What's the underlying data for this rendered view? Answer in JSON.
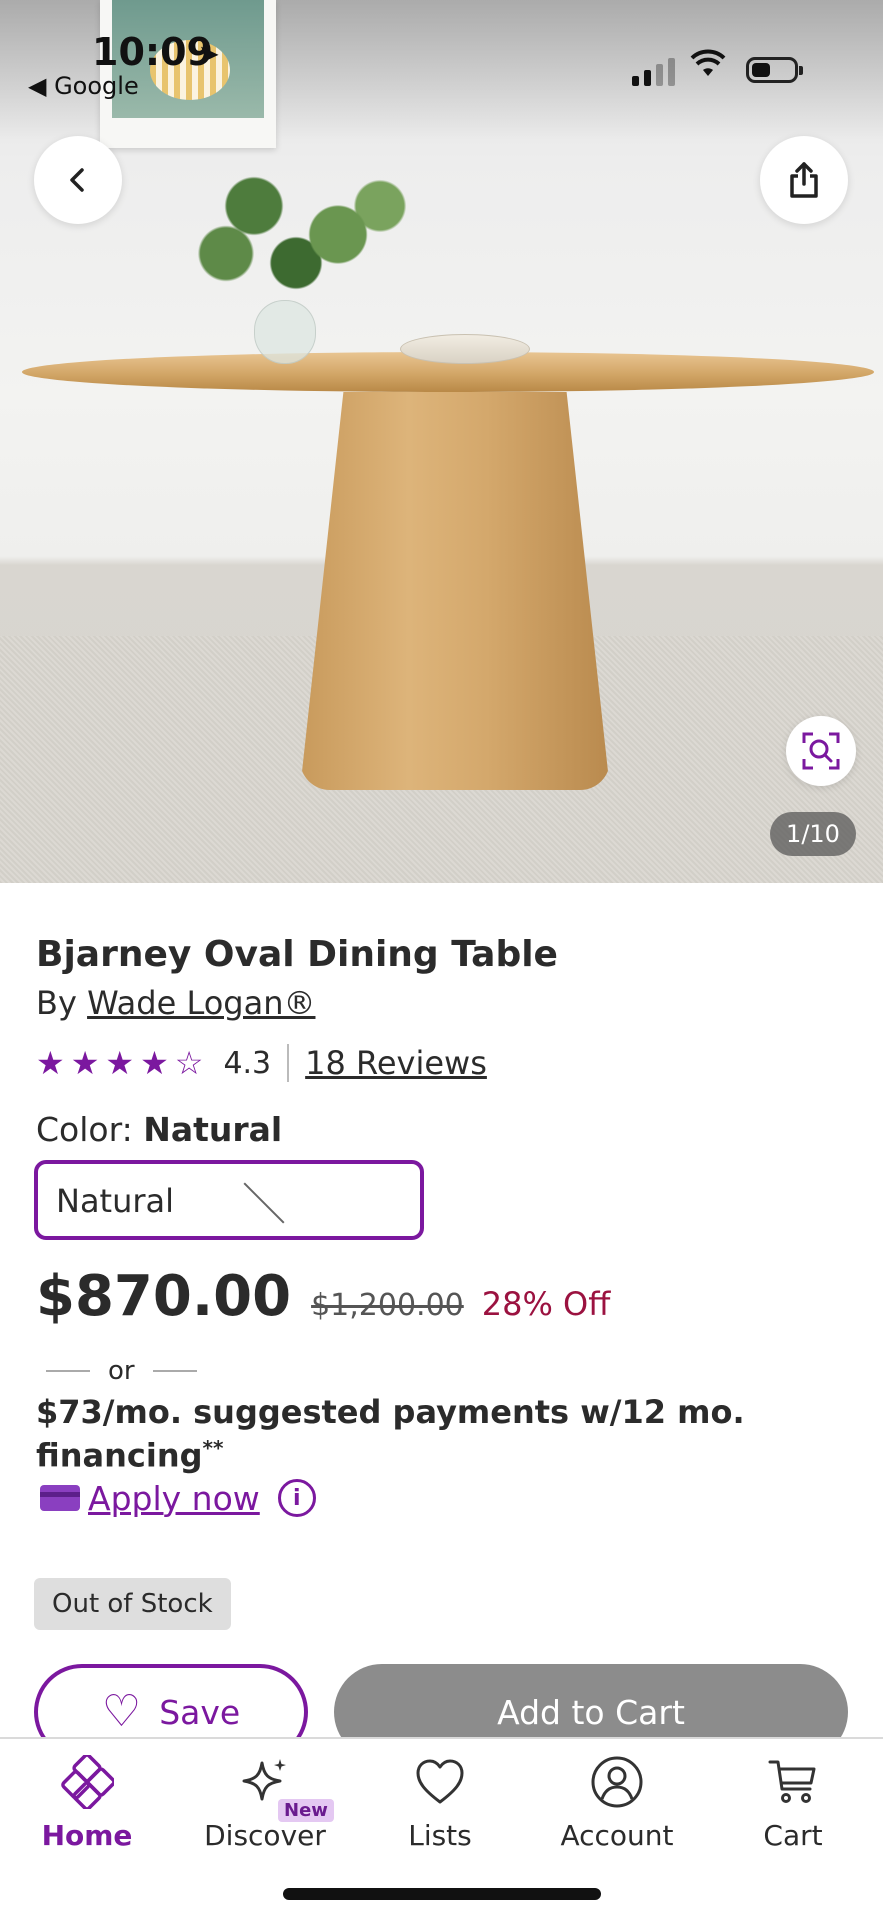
{
  "status_bar": {
    "time": "10:09",
    "back_app": "◀ Google"
  },
  "hero": {
    "image_counter": "1/10"
  },
  "product": {
    "title": "Bjarney Oval Dining Table",
    "by_prefix": "By",
    "brand": "Wade Logan®",
    "rating": "4.3",
    "rating_value": 4.3,
    "reviews": "18 Reviews",
    "color_label": "Color:",
    "color_value": "Natural",
    "swatch_label": "Natural",
    "price": "$870.00",
    "was_price": "$1,200.00",
    "discount": "28% Off",
    "or_text": "or",
    "financing": "$73/mo. suggested payments w/12 mo. financing",
    "financing_mark": "**",
    "apply_label": "Apply now",
    "stock_status": "Out of Stock",
    "save_label": "Save",
    "add_to_cart_label": "Add to Cart"
  },
  "nav": {
    "items": [
      {
        "label": "Home",
        "icon": "home-icon",
        "active": true
      },
      {
        "label": "Discover",
        "icon": "sparkle-icon",
        "badge": "New"
      },
      {
        "label": "Lists",
        "icon": "heart-icon"
      },
      {
        "label": "Account",
        "icon": "account-icon"
      },
      {
        "label": "Cart",
        "icon": "cart-icon"
      }
    ]
  },
  "colors": {
    "accent": "#7b189f",
    "discount": "#9b1240",
    "disabled_button": "#8c8c8c"
  }
}
